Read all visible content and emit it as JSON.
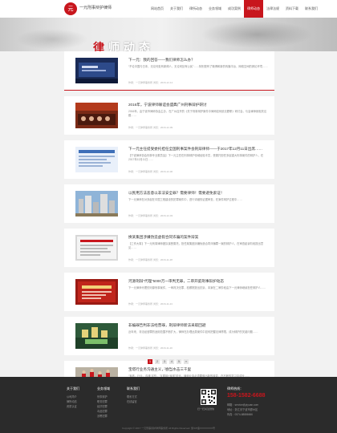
{
  "header": {
    "logo_text": "元",
    "brand": "一元刑事辩护律师",
    "nav": [
      "网站首页",
      "关于我们",
      "律所动态",
      "业务领域",
      "成功案例",
      "律师动态",
      "法律法规",
      "资料下载",
      "联系我们"
    ],
    "active_index": 5
  },
  "banner": {
    "title_lead": "律",
    "title_rest": "师动态"
  },
  "articles": [
    {
      "title": "下一元：我的回答——我们律师怎么办？",
      "summary": "“不论中国与日本，无论何处有新闻人，无论何处有公民”……特别是有了微博和新的传播平台，网络空间的舆论环境……",
      "meta": "作者：一元律师事务所   浏览：2016-12-14"
    },
    {
      "title": "2016年，宁波律师联谊会盛典广州刑事辩护研讨",
      "summary": "2016年，由宁波市律师协会主办，在广州召开的《关于刑事辩护案件中律师如何依法履职》研讨会，与会律师就相关议题……",
      "meta": "作者：一元律师事务所   浏览：2016-12-09"
    },
    {
      "title": "下一元主任提受委托担任全国刑事案件会刑辩律师——于2017年12月11日出席……",
      "summary": "【宁波律师协会刑事专业委员会】下一元主任在刑事辩护领域经验丰富，受委托担任多起重大刑事案件的辩护人，在2017年12月11日……",
      "meta": "作者：一元律师事务所   浏览：2016-12-06"
    },
    {
      "title": "以民用方法恶意以非法安全罪？需要律师！需要避免索证！",
      "summary": "下一元律师在对多起在中国工程建设的犯罪案件中，进行详细的证据审查，在案件辩护过程中……",
      "meta": "作者：一元律师事务所   浏览：2016-12-03"
    },
    {
      "title": "换某集团涉嫌伪造虚假合同诈骗的案件辩案",
      "summary": "【工作大事】下一元刑事律师团队接受委托，担任某集团涉嫌伪造合同诈骗罪一案的辩护人，在审查起诉阶段提出意见……",
      "meta": "作者：一元律师事务所   浏览：2016-11-28"
    },
    {
      "title": "河源刑辩“代理”5000万一审判无罪，二审开庭刑事辩护动态",
      "summary": "下一元律师代理的河源刑事案件，一审判决无罪，检察院提出抗诉，本案在二审阶段由下一元律师继续担任辩护人……",
      "meta": "作者：一元律师事务所   浏览：2016-11-24"
    },
    {
      "title": "非编罪告判非法经营罪，刑辩律师新法采取回避",
      "summary": "近年来，非法经营罪的适用范围不断扩大，律师在办理此类案件中如何把握法律界限，成为辩护的关键问题……",
      "meta": "作者：一元律师事务所   浏览：2016-11-20"
    },
    {
      "title": "宝塔行业务沟通主义，会当水击三千里",
      "summary": "“宝塔、行业、沟通”这些，“互联网+宝塔”时代，律师业务必须要做出新的转变，在不断的学习中成长……",
      "meta": "作者：一元律师事务所   浏览：2016-11-16"
    }
  ],
  "pager": {
    "pages": [
      "1",
      "2",
      "3",
      "4",
      "5",
      "»"
    ],
    "current_index": 0,
    "info": "共5页"
  },
  "footer": {
    "col1": {
      "heading": "关于我们",
      "links": [
        "公司简介",
        "律所动态",
        "资质认证"
      ]
    },
    "col2": {
      "heading": "业务领域",
      "links": [
        "刑事辩护",
        "职务犯罪",
        "经济犯罪",
        "毒品犯罪",
        "涉黑犯罪"
      ]
    },
    "col3": {
      "heading": "联系我们",
      "links": [
        "联系方式",
        "在线留言"
      ]
    },
    "qr_caption": "扫一扫关注微信",
    "contact_heading": "律师热线：",
    "phone": "158-1582-6688",
    "contact_lines": [
      "邮箱：service@yiyuan.com",
      "地址：浙江省宁波市鄞州区",
      "传真：0574-88886666"
    ],
    "copyright": "Copyright © 2017 一元刑事辩护律师事务所 All Rights Reserved. 浙ICP备XXXXXXXX号"
  },
  "colors": {
    "accent": "#c8161d",
    "footer_bg": "#2b2b2b",
    "page_bg": "#f2f2f2"
  }
}
